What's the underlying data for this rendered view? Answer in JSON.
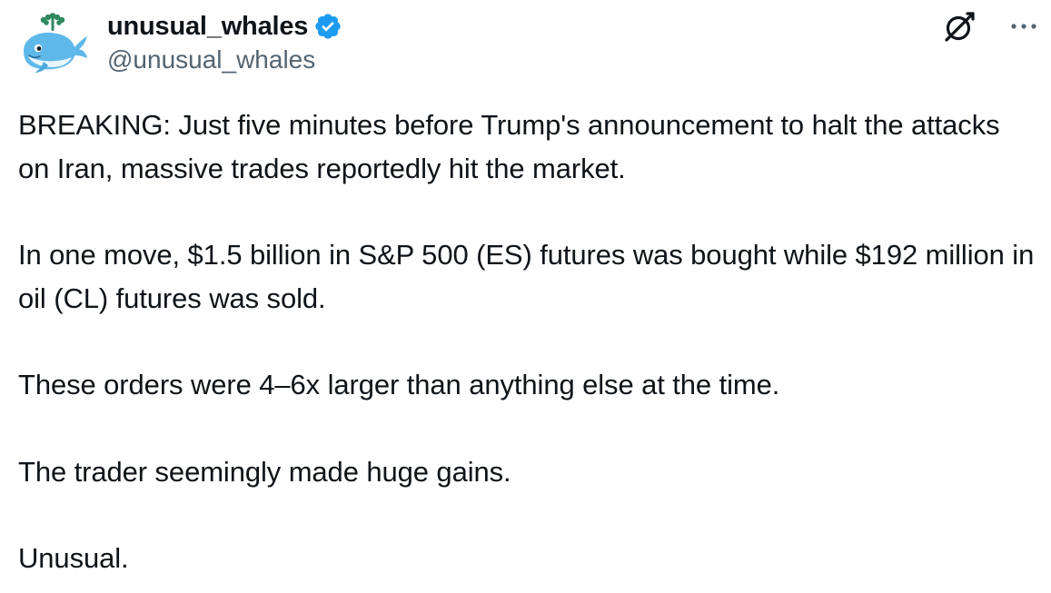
{
  "author": {
    "display_name": "unusual_whales",
    "handle": "@unusual_whales",
    "verified": true,
    "avatar_icon": "whale-avatar-icon",
    "verified_color": "#1d9bf0"
  },
  "header_actions": {
    "grok_icon": "grok-icon",
    "more_icon": "more-options-icon"
  },
  "tweet": {
    "paragraphs": [
      "BREAKING: Just five minutes before Trump's announcement to halt the attacks on Iran, massive trades reportedly hit the market.",
      "In one move, $1.5 billion in S&P 500 (ES) futures was bought while $192 million in oil (CL) futures was sold.",
      "These orders were 4–6x larger than anything else at the time.",
      "The trader seemingly made huge gains.",
      "Unusual."
    ]
  },
  "colors": {
    "text_primary": "#0f1419",
    "text_secondary": "#536471",
    "background": "#ffffff"
  }
}
